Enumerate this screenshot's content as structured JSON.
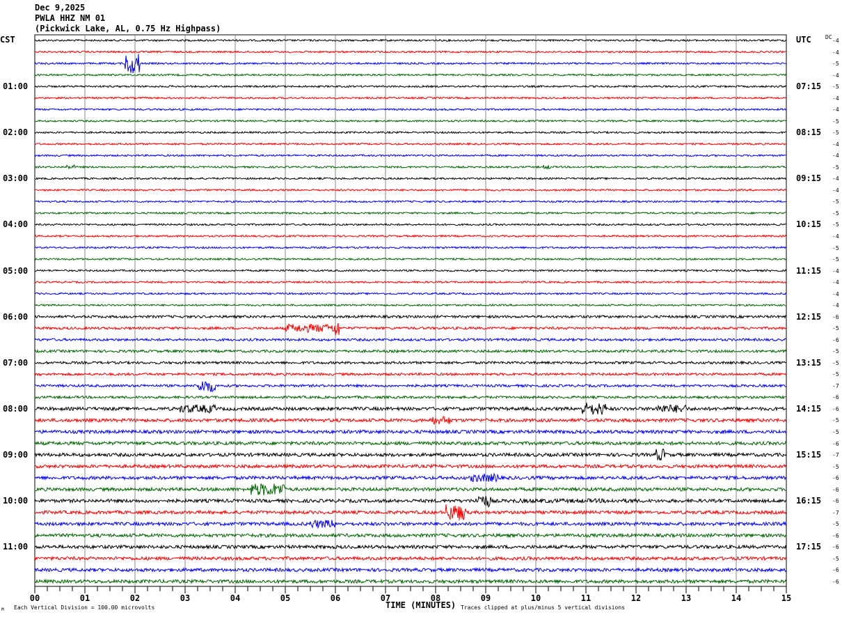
{
  "header": {
    "date": "Dec 9,2025",
    "station": "PWLA HHZ NM 01",
    "location": "(Pickwick Lake, AL, 0.75 Hz Highpass)"
  },
  "left_tz": "CST",
  "right_tz": "UTC",
  "dc_label": "DC",
  "footer": {
    "scale_note": "Each Vertical Division =  100.00 microvolts",
    "clip_note": "Traces clipped at plus/minus 5 vertical divisions",
    "corner_mark": "M"
  },
  "chart_data": {
    "type": "line",
    "xlabel": "TIME (MINUTES)",
    "xlim": [
      0,
      15
    ],
    "x_ticks": [
      "00",
      "01",
      "02",
      "03",
      "04",
      "05",
      "06",
      "07",
      "08",
      "09",
      "10",
      "11",
      "12",
      "13",
      "14",
      "15"
    ],
    "trace_colors": [
      "#000000",
      "#ff0000",
      "#0000ff",
      "#006400"
    ],
    "grid": true,
    "traces_per_hour": 4,
    "left_hour_labels": [
      "",
      "01:00",
      "02:00",
      "03:00",
      "04:00",
      "05:00",
      "06:00",
      "07:00",
      "08:00",
      "09:00",
      "10:00",
      "11:00"
    ],
    "right_hour_labels": [
      "",
      "07:15",
      "08:15",
      "09:15",
      "10:15",
      "11:15",
      "12:15",
      "13:15",
      "14:15",
      "15:15",
      "16:15",
      "17:15"
    ],
    "dc_offsets": [
      "-4",
      "-4",
      "-5",
      "-4",
      "-5",
      "-4",
      "-4",
      "-5",
      "-5",
      "-4",
      "-4",
      "-5",
      "-4",
      "-4",
      "-5",
      "-5",
      "-5",
      "-4",
      "-5",
      "-5",
      "-4",
      "-4",
      "-4",
      "-4",
      "-6",
      "-5",
      "-6",
      "-5",
      "-5",
      "-5",
      "-7",
      "-6",
      "-6",
      "-5",
      "-5",
      "-6",
      "-7",
      "-5",
      "-6",
      "-6",
      "-6",
      "-7",
      "-5",
      "-6",
      "-6",
      "-5",
      "-6",
      "-6"
    ],
    "events": [
      {
        "trace": 2,
        "start_min": 1.8,
        "end_min": 2.1,
        "amplitude_div": 5
      },
      {
        "trace": 11,
        "start_min": 0.6,
        "end_min": 0.8,
        "amplitude_div": 1
      },
      {
        "trace": 11,
        "start_min": 10.15,
        "end_min": 10.3,
        "amplitude_div": 1
      },
      {
        "trace": 25,
        "start_min": 5.0,
        "end_min": 6.0,
        "amplitude_div": 2
      },
      {
        "trace": 25,
        "start_min": 5.95,
        "end_min": 6.1,
        "amplitude_div": 4
      },
      {
        "trace": 30,
        "start_min": 3.25,
        "end_min": 3.6,
        "amplitude_div": 3
      },
      {
        "trace": 32,
        "start_min": 2.9,
        "end_min": 3.6,
        "amplitude_div": 2
      },
      {
        "trace": 32,
        "start_min": 10.9,
        "end_min": 11.4,
        "amplitude_div": 3
      },
      {
        "trace": 32,
        "start_min": 12.4,
        "end_min": 13.0,
        "amplitude_div": 2
      },
      {
        "trace": 33,
        "start_min": 7.9,
        "end_min": 8.3,
        "amplitude_div": 2
      },
      {
        "trace": 36,
        "start_min": 12.4,
        "end_min": 12.6,
        "amplitude_div": 3
      },
      {
        "trace": 38,
        "start_min": 8.7,
        "end_min": 9.3,
        "amplitude_div": 2
      },
      {
        "trace": 39,
        "start_min": 4.3,
        "end_min": 5.0,
        "amplitude_div": 3
      },
      {
        "trace": 40,
        "start_min": 8.8,
        "end_min": 9.1,
        "amplitude_div": 3
      },
      {
        "trace": 40,
        "start_min": 9.5,
        "end_min": 12.0,
        "amplitude_div": 1
      },
      {
        "trace": 41,
        "start_min": 8.2,
        "end_min": 8.6,
        "amplitude_div": 4
      },
      {
        "trace": 42,
        "start_min": 5.5,
        "end_min": 6.0,
        "amplitude_div": 2
      }
    ]
  }
}
